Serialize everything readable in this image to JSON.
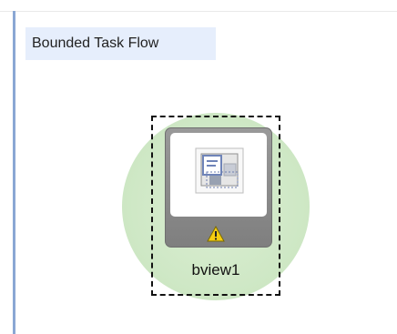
{
  "flow": {
    "title": "Bounded Task Flow"
  },
  "activity": {
    "label": "bview1",
    "icon": "view-activity-icon",
    "warning_icon": "warning-icon"
  },
  "colors": {
    "header_bg": "#e6eefc",
    "left_rail": "#8aa7d4",
    "glow": "#cfe8c6",
    "tile": "#8f8f8f",
    "warning": "#f5c400"
  }
}
